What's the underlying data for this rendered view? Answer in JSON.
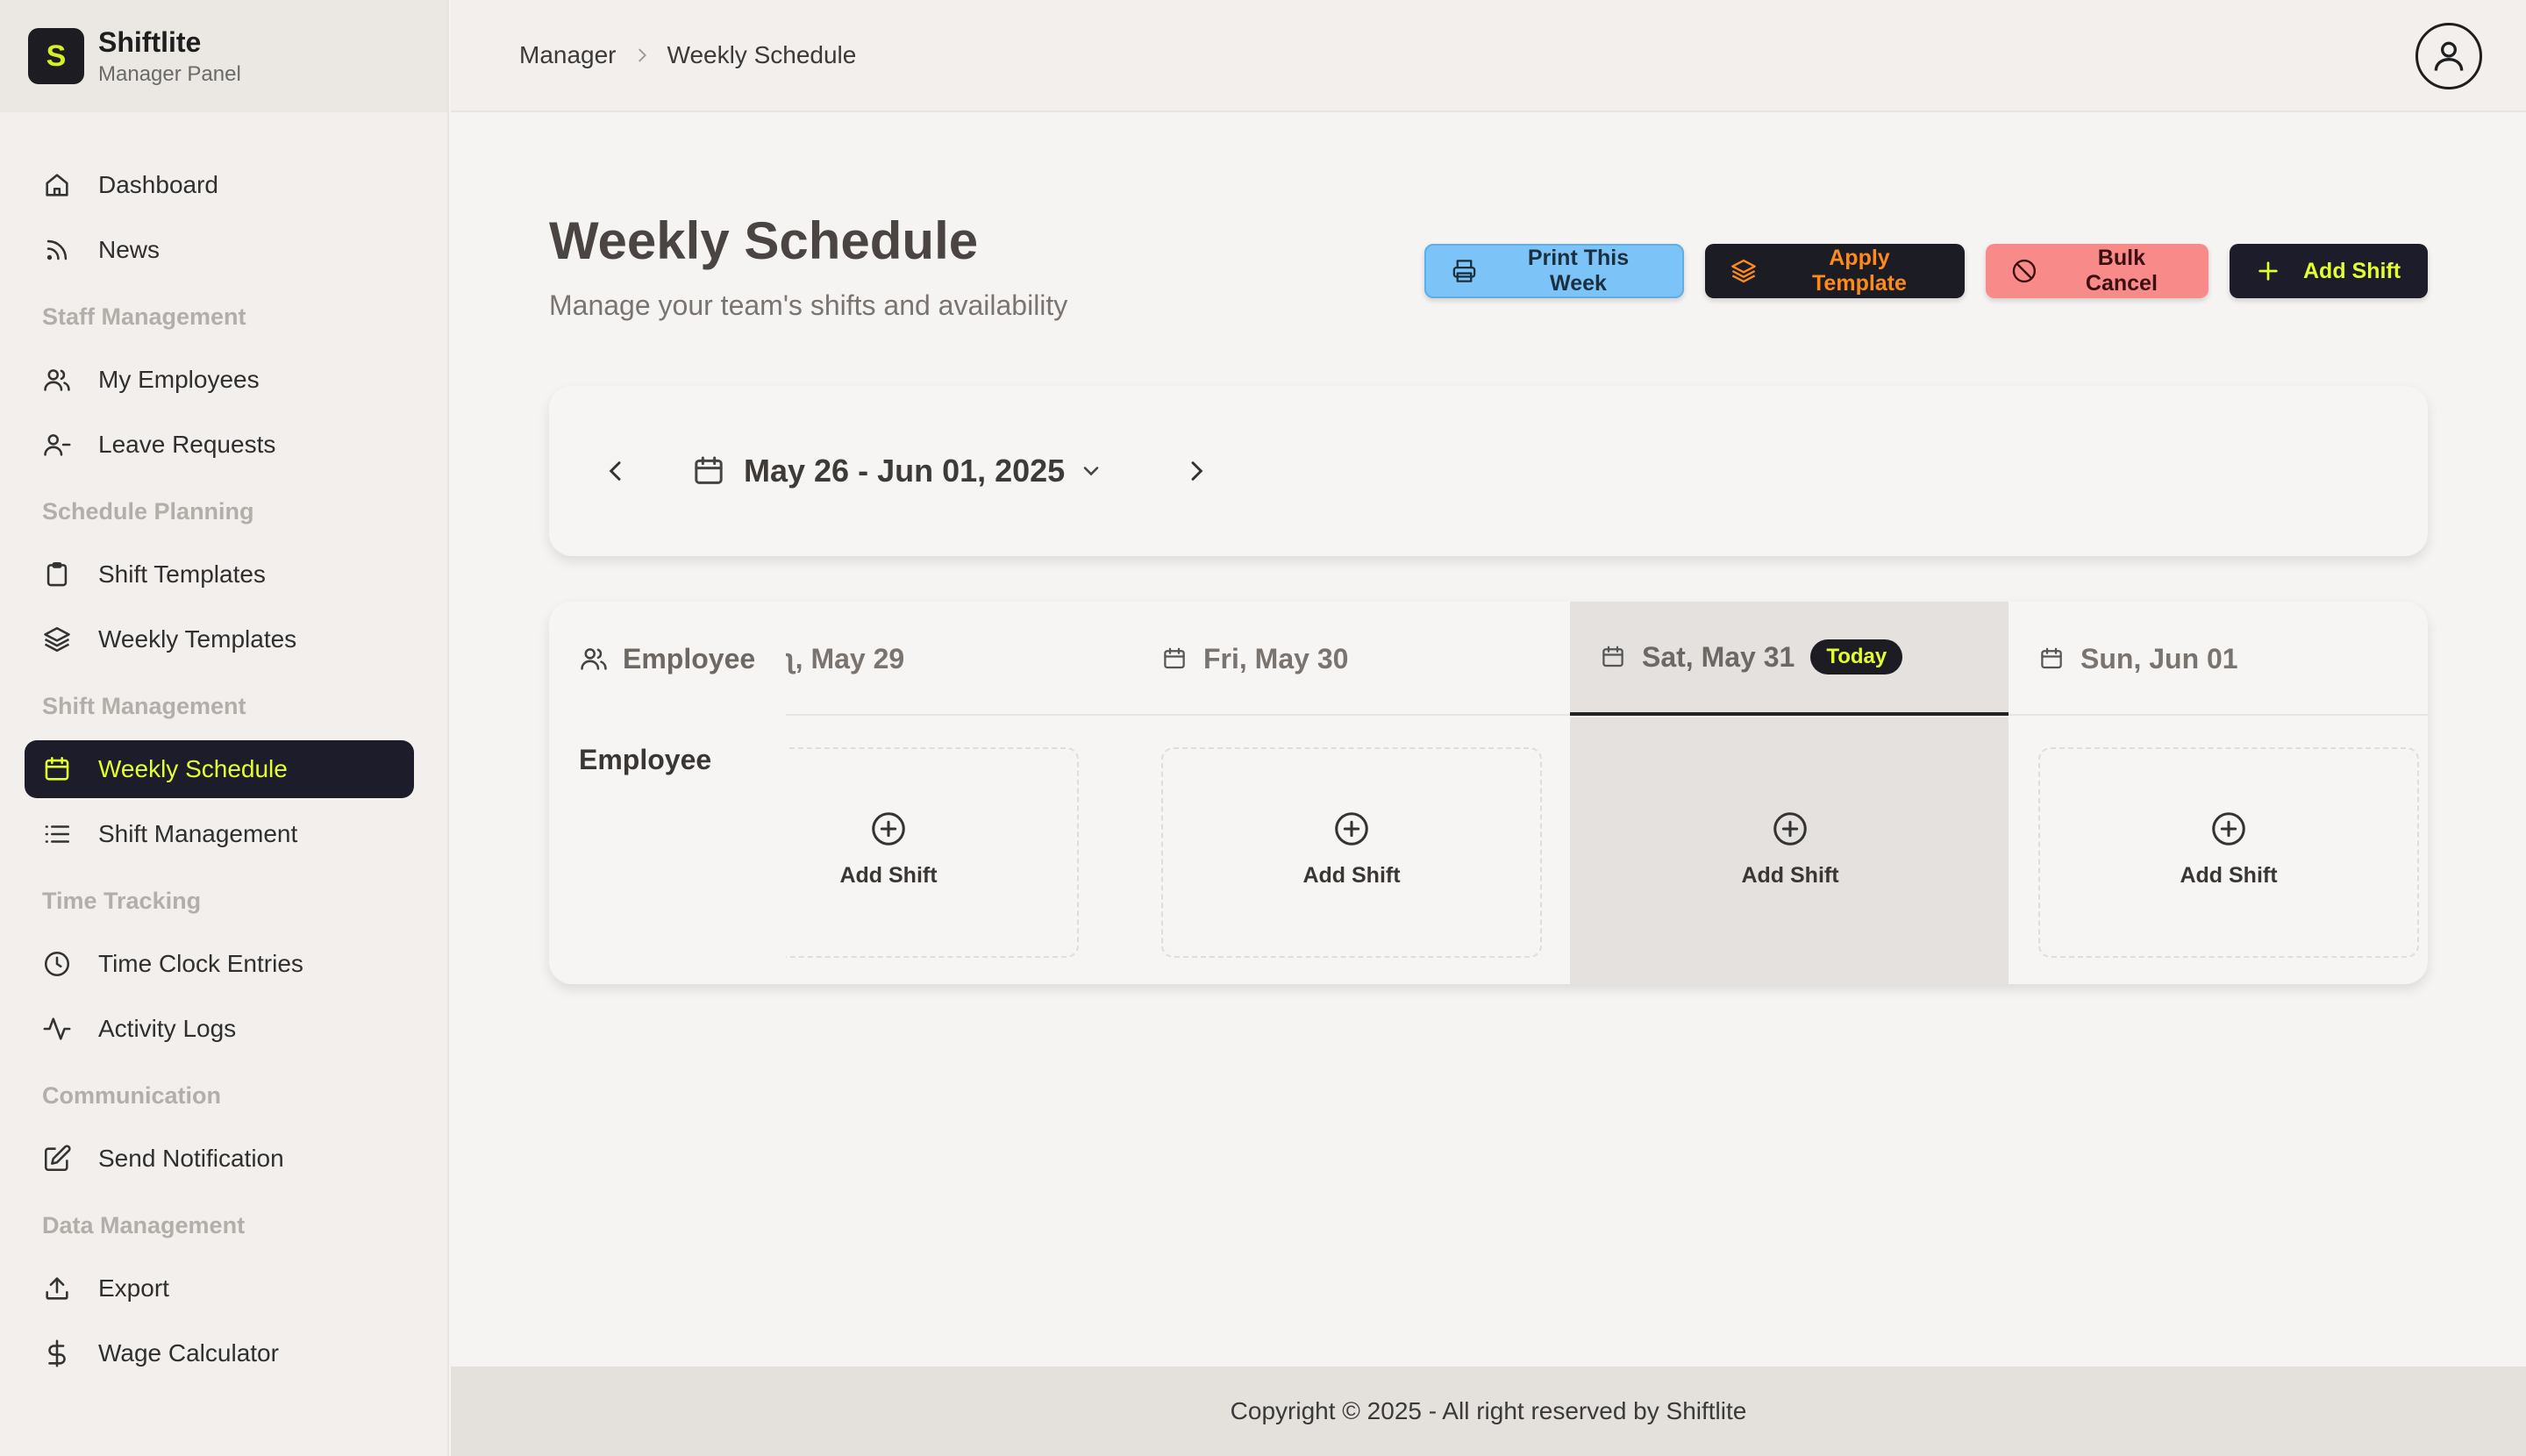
{
  "brand": {
    "name": "Shiftlite",
    "subtitle": "Manager Panel",
    "logo_letter": "S"
  },
  "colors": {
    "accent": "#e3ff2c",
    "dark": "#1c1c2a",
    "print": "#7cc4f7",
    "template_text": "#ff8a1a",
    "bulk": "#f98a8a"
  },
  "sidebar": {
    "items": [
      {
        "label": "Dashboard",
        "icon": "home-icon"
      },
      {
        "label": "News",
        "icon": "rss-icon"
      }
    ],
    "sections": [
      {
        "title": "Staff Management",
        "items": [
          {
            "label": "My Employees",
            "icon": "users-icon"
          },
          {
            "label": "Leave Requests",
            "icon": "user-minus-icon"
          }
        ]
      },
      {
        "title": "Schedule Planning",
        "items": [
          {
            "label": "Shift Templates",
            "icon": "clipboard-icon"
          },
          {
            "label": "Weekly Templates",
            "icon": "layers-icon"
          }
        ]
      },
      {
        "title": "Shift Management",
        "items": [
          {
            "label": "Weekly Schedule",
            "icon": "calendar-icon",
            "active": true
          },
          {
            "label": "Shift Management",
            "icon": "list-icon"
          }
        ]
      },
      {
        "title": "Time Tracking",
        "items": [
          {
            "label": "Time Clock Entries",
            "icon": "clock-icon"
          },
          {
            "label": "Activity Logs",
            "icon": "activity-icon"
          }
        ]
      },
      {
        "title": "Communication",
        "items": [
          {
            "label": "Send Notification",
            "icon": "edit-icon"
          }
        ]
      },
      {
        "title": "Data Management",
        "items": [
          {
            "label": "Export",
            "icon": "upload-icon"
          },
          {
            "label": "Wage Calculator",
            "icon": "dollar-icon"
          }
        ]
      }
    ]
  },
  "breadcrumb": {
    "parent": "Manager",
    "current": "Weekly Schedule"
  },
  "page": {
    "title": "Weekly Schedule",
    "subtitle": "Manage your team's shifts and availability"
  },
  "actions": {
    "print": "Print This Week",
    "template": "Apply Template",
    "bulk_cancel": "Bulk Cancel",
    "add_shift": "Add Shift"
  },
  "week": {
    "label": "May 26 - Jun 01, 2025"
  },
  "schedule": {
    "employee_header": "Employee",
    "employee_row_label": "Employee",
    "days": [
      {
        "label": "ʅ, May 29",
        "today": false
      },
      {
        "label": "Fri, May 30",
        "today": false
      },
      {
        "label": "Sat, May 31",
        "today": true
      },
      {
        "label": "Sun, Jun 01",
        "today": false
      }
    ],
    "today_badge": "Today",
    "slot_label": "Add Shift"
  },
  "footer": {
    "text": "Copyright © 2025 - All right reserved by Shiftlite"
  }
}
